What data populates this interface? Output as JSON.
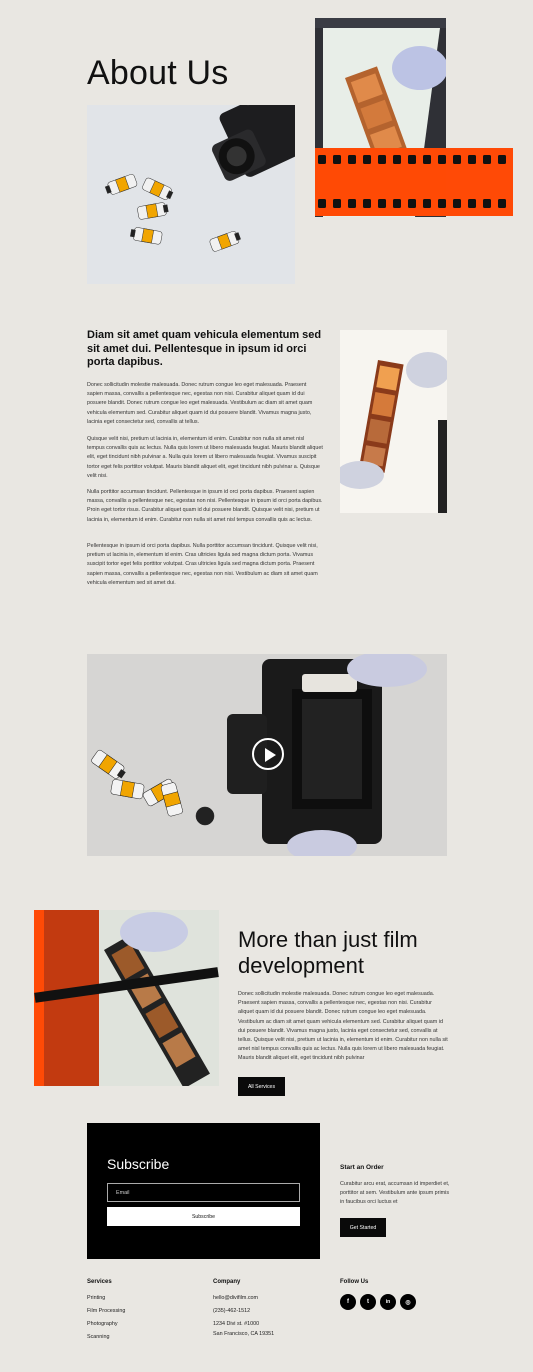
{
  "hero": {
    "title": "About Us"
  },
  "intro": {
    "heading": "Diam sit amet quam vehicula elementum sed sit amet dui. Pellentesque in ipsum id orci porta dapibus.",
    "paragraphs": [
      "Donec sollicitudin molestie malesuada. Donec rutrum congue leo eget malesuada. Praesent sapien massa, convallis a pellentesque nec, egestas non nisi. Curabitur aliquet quam id dui posuere blandit. Donec rutrum congue leo eget malesuada. Vestibulum ac diam sit amet quam vehicula elementum sed. Curabitur aliquet quam id dui posuere blandit. Vivamus magna justo, lacinia eget consectetur sed, convallis at tellus.",
      "Quisque velit nisi, pretium ut lacinia in, elementum id enim. Curabitur non nulla sit amet nisl tempus convallis quis ac lectus. Nulla quis lorem ut libero malesuada feugiat. Mauris blandit aliquet elit, eget tincidunt nibh pulvinar a. Nulla quis lorem ut libero malesuada feugiat. Vivamus suscipit tortor eget felis porttitor volutpat. Mauris blandit aliquet elit, eget tincidunt nibh pulvinar a. Quisque velit nisi.",
      "Nulla porttitor accumsan tincidunt. Pellentesque in ipsum id orci porta dapibus. Praesent sapien massa, convallis a pellentesque nec, egestas non nisi. Pellentesque in ipsum id orci porta dapibus. Proin eget tortor risus. Curabitur aliquet quam id dui posuere blandit. Quisque velit nisi, pretium ut lacinia in, elementum id enim. Curabitur non nulla sit amet nisl tempus convallis quis ac lectus.",
      "Pellentesque in ipsum id orci porta dapibus. Nulla porttitor accumsan tincidunt. Quisque velit nisi, pretium ut lacinia in, elementum id enim. Cras ultricies ligula sed magna dictum porta. Vivamus suscipit tortor eget felis porttitor volutpat. Cras ultricies ligula sed magna dictum porta. Praesent sapien massa, convallis a pellentesque nec, egestas non nisi. Vestibulum ac diam sit amet quam vehicula elementum sed sit amet dui."
    ]
  },
  "video": {
    "play_icon": "play-icon"
  },
  "services_section": {
    "title": "More than just film development",
    "paragraph": "Donec sollicitudin molestie malesuada. Donec rutrum congue leo eget malesuada. Praesent sapien massa, convallis a pellentesque nec, egestas non nisi. Curabitur aliquet quam id dui posuere blandit. Donec rutrum congue leo eget malesuada. Vestibulum ac diam sit amet quam vehicula elementum sed. Curabitur aliquet quam id dui posuere blandit. Vivamus magna justo, lacinia eget consectetur sed, convallis at tellus. Quisque velit nisi, pretium ut lacinia in, elementum id enim. Curabitur non nulla sit amet nisl tempus convallis quis ac lectus. Nulla quis lorem ut libero malesuada feugiat. Mauris blandit aliquet elit, eget tincidunt nibh pulvinar",
    "button_label": "All Services"
  },
  "subscribe": {
    "title": "Subscribe",
    "email_placeholder": "Email",
    "button_label": "Subscribe"
  },
  "start_order": {
    "title": "Start an Order",
    "text": "Curabitur arcu erat, accumsan id imperdiet et, porttitor at sem. Vestibulum ante ipsum primis in faucibus orci luctus et",
    "button_label": "Get Started"
  },
  "footer": {
    "services_title": "Services",
    "services": [
      "Printing",
      "Film Processing",
      "Photography",
      "Scanning"
    ],
    "company_title": "Company",
    "email": "hello@divifilm.com",
    "phone": "(235)-462-1512",
    "address_line1": "1234 Divi st. #1000",
    "address_line2": "San Francisco, CA 19351",
    "follow_title": "Follow Us",
    "social": [
      {
        "icon": "facebook-icon",
        "glyph": "f"
      },
      {
        "icon": "twitter-icon",
        "glyph": "t"
      },
      {
        "icon": "linkedin-icon",
        "glyph": "in"
      },
      {
        "icon": "instagram-icon",
        "glyph": "◎"
      }
    ]
  },
  "colors": {
    "background": "#e9e7e2",
    "accent": "#ff4a06",
    "dark": "#000000"
  }
}
